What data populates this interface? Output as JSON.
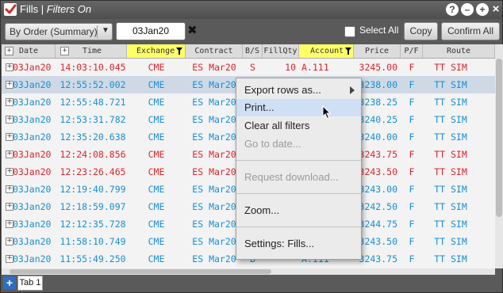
{
  "window": {
    "title": "Fills",
    "title_sep": " | ",
    "title_status": "Filters On"
  },
  "titlebar_buttons": [
    "?",
    "–",
    "+",
    "×"
  ],
  "toolbar": {
    "order_dropdown": "By Order (Summary)",
    "date_value": "03Jan20",
    "select_all_label": "Select All",
    "copy_label": "Copy",
    "confirm_all_label": "Confirm All"
  },
  "grid": {
    "columns": [
      "Date",
      "Time",
      "Exchange",
      "Contract",
      "B/S",
      "FillQty",
      "Account",
      "Price",
      "P/F",
      "Route"
    ],
    "rows": [
      {
        "date": "03Jan20",
        "time": "14:03:10.045",
        "exchange": "CME",
        "contract": "ES Mar20",
        "bs": "S",
        "qty": "10",
        "account": "A.111",
        "price": "3245.00",
        "pf": "F",
        "route": "TT SIM",
        "side": "sell"
      },
      {
        "date": "03Jan20",
        "time": "12:55:52.002",
        "exchange": "CME",
        "contract": "ES Mar20",
        "bs": "",
        "qty": "",
        "account": "",
        "price": "3238.00",
        "pf": "F",
        "route": "TT SIM",
        "side": "buy"
      },
      {
        "date": "03Jan20",
        "time": "12:55:48.721",
        "exchange": "CME",
        "contract": "ES Mar20",
        "bs": "",
        "qty": "",
        "account": "",
        "price": "3238.25",
        "pf": "F",
        "route": "TT SIM",
        "side": "buy"
      },
      {
        "date": "03Jan20",
        "time": "12:53:31.782",
        "exchange": "CME",
        "contract": "ES Mar20",
        "bs": "",
        "qty": "",
        "account": "",
        "price": "3240.25",
        "pf": "F",
        "route": "TT SIM",
        "side": "buy"
      },
      {
        "date": "03Jan20",
        "time": "12:35:20.638",
        "exchange": "CME",
        "contract": "ES Mar20",
        "bs": "",
        "qty": "",
        "account": "",
        "price": "3240.00",
        "pf": "F",
        "route": "TT SIM",
        "side": "buy"
      },
      {
        "date": "03Jan20",
        "time": "12:24:08.856",
        "exchange": "CME",
        "contract": "ES Mar20",
        "bs": "",
        "qty": "",
        "account": "",
        "price": "3243.75",
        "pf": "F",
        "route": "TT SIM",
        "side": "sell"
      },
      {
        "date": "03Jan20",
        "time": "12:23:26.465",
        "exchange": "CME",
        "contract": "ES Mar20",
        "bs": "",
        "qty": "",
        "account": "",
        "price": "3243.50",
        "pf": "F",
        "route": "TT SIM",
        "side": "sell"
      },
      {
        "date": "03Jan20",
        "time": "12:19:40.799",
        "exchange": "CME",
        "contract": "ES Mar20",
        "bs": "",
        "qty": "",
        "account": "",
        "price": "3243.00",
        "pf": "F",
        "route": "TT SIM",
        "side": "buy"
      },
      {
        "date": "03Jan20",
        "time": "12:18:59.097",
        "exchange": "CME",
        "contract": "ES Mar20",
        "bs": "",
        "qty": "",
        "account": "",
        "price": "3242.50",
        "pf": "F",
        "route": "TT SIM",
        "side": "buy"
      },
      {
        "date": "03Jan20",
        "time": "12:12:35.728",
        "exchange": "CME",
        "contract": "ES Mar20",
        "bs": "",
        "qty": "",
        "account": "",
        "price": "3244.75",
        "pf": "F",
        "route": "TT SIM",
        "side": "buy"
      },
      {
        "date": "03Jan20",
        "time": "11:58:10.749",
        "exchange": "CME",
        "contract": "ES Mar20",
        "bs": "",
        "qty": "",
        "account": "",
        "price": "3243.50",
        "pf": "F",
        "route": "TT SIM",
        "side": "buy"
      },
      {
        "date": "03Jan20",
        "time": "11:55:49.250",
        "exchange": "CME",
        "contract": "ES Mar20",
        "bs": "B",
        "qty": "",
        "account": "A.111",
        "price": "3243.75",
        "pf": "F",
        "route": "TT SIM",
        "side": "buy"
      }
    ]
  },
  "context_menu": {
    "items": [
      {
        "label": "Export rows as...",
        "enabled": true,
        "submenu": true
      },
      {
        "label": "Print...",
        "enabled": true,
        "hover": true
      },
      {
        "label": "Clear all filters",
        "enabled": true
      },
      {
        "label": "Go to date...",
        "enabled": false
      },
      {
        "label": "Request download...",
        "enabled": false
      },
      {
        "label": "Zoom...",
        "enabled": true
      },
      {
        "label": "Settings: Fills...",
        "enabled": true
      }
    ]
  },
  "tabs": {
    "add_label": "+",
    "items": [
      "Tab 1"
    ]
  },
  "colors": {
    "buy": "#1a8fd0",
    "sell": "#e0242c",
    "filter_highlight": "#ffff66",
    "selected_row": "#cfd9e6",
    "menu_hover": "#cfe0f5"
  }
}
